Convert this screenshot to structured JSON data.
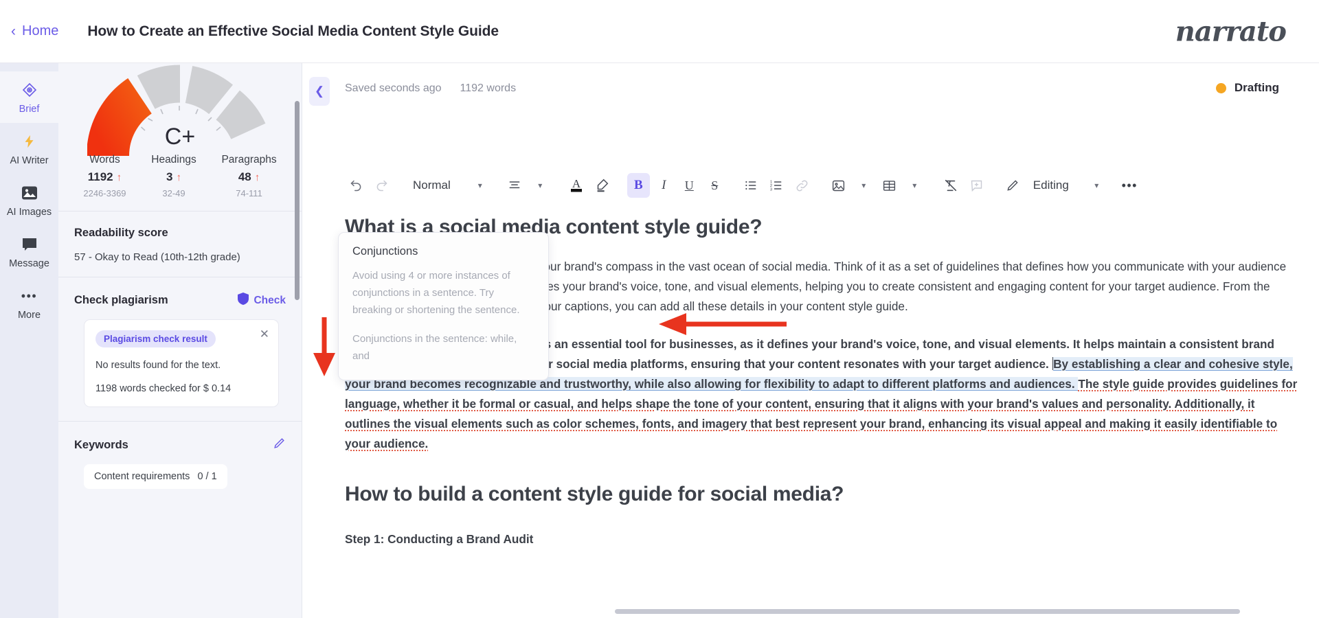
{
  "topbar": {
    "home_label": "Home",
    "home_icon": "chevron-left-icon",
    "doc_title": "How to Create an Effective Social Media Content Style Guide",
    "brand": "narrato"
  },
  "rail": {
    "items": [
      {
        "label": "Brief",
        "icon": "target-diamond-icon",
        "active": true
      },
      {
        "label": "AI Writer",
        "icon": "lightning-bolt-icon",
        "active": false
      },
      {
        "label": "AI Images",
        "icon": "image-icon",
        "active": false
      },
      {
        "label": "Message",
        "icon": "chat-bubble-icon",
        "active": false
      },
      {
        "label": "More",
        "icon": "ellipsis-icon",
        "active": false
      }
    ]
  },
  "panel": {
    "gauge": {
      "grade": "C+",
      "fill_color": "#f03c14",
      "track_color": "#cfd0d3"
    },
    "stats": [
      {
        "name": "Words",
        "value": "1192",
        "arrow": "↑",
        "range": "2246-3369"
      },
      {
        "name": "Headings",
        "value": "3",
        "arrow": "↑",
        "range": "32-49"
      },
      {
        "name": "Paragraphs",
        "value": "48",
        "arrow": "↑",
        "range": "74-111"
      }
    ],
    "readability": {
      "title": "Readability score",
      "value": "57 - Okay to Read (10th-12th grade)"
    },
    "plagiarism": {
      "title": "Check plagiarism",
      "check_label": "Check",
      "check_icon": "shield-icon",
      "accent": "#5a4ae3",
      "result_chip": "Plagiarism check result",
      "close_icon": "close-icon",
      "line1": "No results found for the text.",
      "line2": "1198 words checked for $ 0.14"
    },
    "keywords": {
      "title": "Keywords",
      "edit_icon": "pencil-icon",
      "chip_label": "Content requirements",
      "chip_count": "0 / 1"
    }
  },
  "editor": {
    "collapse_icon": "chevron-left-icon",
    "saved_text": "Saved seconds ago",
    "word_count": "1192 words",
    "status_label": "Drafting",
    "status_color": "#f5a623",
    "toolbar": {
      "undo_icon": "undo-icon",
      "redo_icon": "redo-icon",
      "style_label": "Normal",
      "style_chevron": "chevron-down-icon",
      "align_icon": "align-icon",
      "align_chevron": "chevron-down-icon",
      "text_color_icon": "text-color-icon",
      "highlight_icon": "highlighter-icon",
      "bold_icon": "bold-icon",
      "italic_icon": "italic-icon",
      "underline_icon": "underline-icon",
      "strike_icon": "strikethrough-icon",
      "bullet_list_icon": "bullet-list-icon",
      "number_list_icon": "numbered-list-icon",
      "link_icon": "link-icon",
      "image_icon": "image-icon",
      "image_chevron": "chevron-down-icon",
      "table_icon": "table-icon",
      "table_chevron": "chevron-down-icon",
      "clear_format_icon": "clear-formatting-icon",
      "comment_icon": "add-comment-icon",
      "mode_icon": "pencil-icon",
      "mode_label": "Editing",
      "mode_chevron": "chevron-down-icon",
      "more_icon": "ellipsis-icon"
    },
    "document": {
      "heading1": "What is a social media content style guide?",
      "para1": "A social media content style guide is your brand's compass in the vast ocean of social media. Think of it as a set of guidelines that defines how you communicate with your audience on your social media platforms. It defines your brand's voice, tone, and visual elements, helping you to create consistent and engaging content for your target audience. From the perfect use of emojis to the length of your captions, you can add all these details in your content style guide.",
      "para2_plain": "A social media content style guide is an essential tool for businesses, as it defines your brand's voice, tone, and visual elements. It helps maintain a consistent brand identity and consistency across your social media platforms, ensuring that your content resonates with your target audience. ",
      "para2_blue": "By establishing a clear and cohesive style, your brand becomes recognizable and trustworthy, while also allowing for flexibility to adapt to different platforms and audiences. ",
      "para2_red": "The style guide provides guidelines for language, whether it be formal or casual, and helps shape the tone of your content, ensuring that it aligns with your brand's values and personality. Additionally, it outlines the visual elements such as color schemes, fonts, and imagery that best represent your brand, enhancing its visual appeal and making it easily identifiable to your audience.",
      "heading2": "How to build a content style guide for social media?",
      "step1": "Step 1: Conducting a Brand Audit"
    }
  },
  "popover": {
    "title": "Conjunctions",
    "body1": "Avoid using 4 or more instances of conjunctions in a sentence. Try breaking or shortening the sentence.",
    "body2": "Conjunctions in the sentence: while, and"
  },
  "annotations": {
    "arrow_color": "#e8341f",
    "arrow_down_name": "red-arrow-pointing-to-check-link",
    "arrow_left_name": "red-arrow-pointing-to-popover"
  }
}
